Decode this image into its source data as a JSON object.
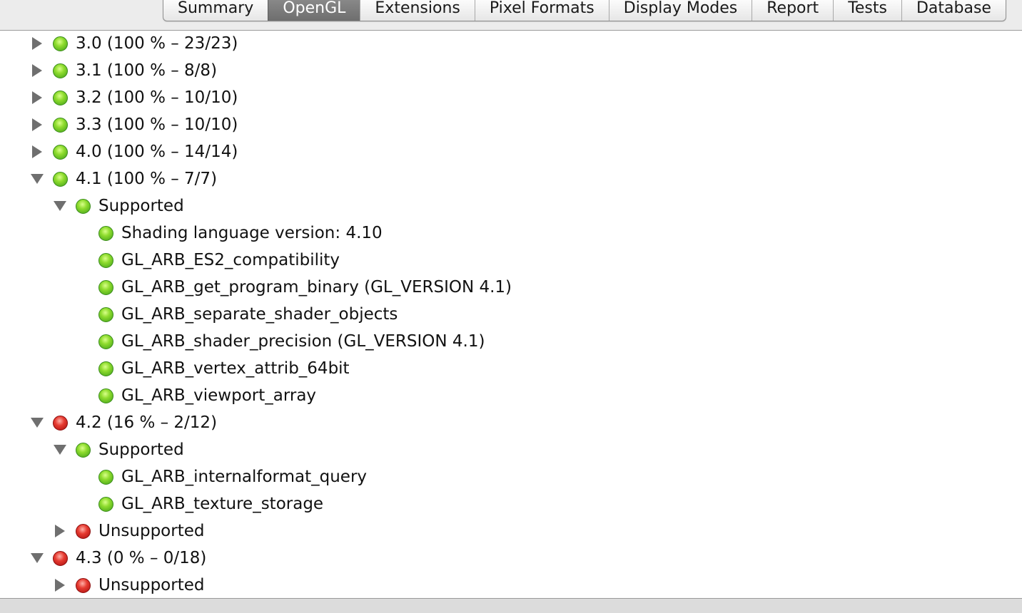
{
  "tabs": [
    {
      "label": "Summary",
      "selected": false
    },
    {
      "label": "OpenGL",
      "selected": true
    },
    {
      "label": "Extensions",
      "selected": false
    },
    {
      "label": "Pixel Formats",
      "selected": false
    },
    {
      "label": "Display Modes",
      "selected": false
    },
    {
      "label": "Report",
      "selected": false
    },
    {
      "label": "Tests",
      "selected": false
    },
    {
      "label": "Database",
      "selected": false
    }
  ],
  "colors": {
    "status_green": "#5cc41e",
    "status_red": "#e0261f",
    "selected_tab": "#7a7a7a"
  },
  "tree": [
    {
      "label": "3.0 (100 % – 23/23)",
      "level": 0,
      "status": "green",
      "expander": "collapsed"
    },
    {
      "label": "3.1 (100 % – 8/8)",
      "level": 0,
      "status": "green",
      "expander": "collapsed"
    },
    {
      "label": "3.2 (100 % – 10/10)",
      "level": 0,
      "status": "green",
      "expander": "collapsed"
    },
    {
      "label": "3.3 (100 % – 10/10)",
      "level": 0,
      "status": "green",
      "expander": "collapsed"
    },
    {
      "label": "4.0 (100 % – 14/14)",
      "level": 0,
      "status": "green",
      "expander": "collapsed"
    },
    {
      "label": "4.1 (100 % – 7/7)",
      "level": 0,
      "status": "green",
      "expander": "expanded"
    },
    {
      "label": "Supported",
      "level": 1,
      "status": "green",
      "expander": "expanded"
    },
    {
      "label": "Shading language version: 4.10",
      "level": 2,
      "status": "green",
      "expander": "none"
    },
    {
      "label": "GL_ARB_ES2_compatibility",
      "level": 2,
      "status": "green",
      "expander": "none"
    },
    {
      "label": "GL_ARB_get_program_binary (GL_VERSION 4.1)",
      "level": 2,
      "status": "green",
      "expander": "none"
    },
    {
      "label": "GL_ARB_separate_shader_objects",
      "level": 2,
      "status": "green",
      "expander": "none"
    },
    {
      "label": "GL_ARB_shader_precision (GL_VERSION 4.1)",
      "level": 2,
      "status": "green",
      "expander": "none"
    },
    {
      "label": "GL_ARB_vertex_attrib_64bit",
      "level": 2,
      "status": "green",
      "expander": "none"
    },
    {
      "label": "GL_ARB_viewport_array",
      "level": 2,
      "status": "green",
      "expander": "none"
    },
    {
      "label": "4.2 (16 % – 2/12)",
      "level": 0,
      "status": "red",
      "expander": "expanded"
    },
    {
      "label": "Supported",
      "level": 1,
      "status": "green",
      "expander": "expanded"
    },
    {
      "label": "GL_ARB_internalformat_query",
      "level": 2,
      "status": "green",
      "expander": "none"
    },
    {
      "label": "GL_ARB_texture_storage",
      "level": 2,
      "status": "green",
      "expander": "none"
    },
    {
      "label": "Unsupported",
      "level": 1,
      "status": "red",
      "expander": "collapsed"
    },
    {
      "label": "4.3 (0 % – 0/18)",
      "level": 0,
      "status": "red",
      "expander": "expanded"
    },
    {
      "label": "Unsupported",
      "level": 1,
      "status": "red",
      "expander": "collapsed"
    }
  ]
}
